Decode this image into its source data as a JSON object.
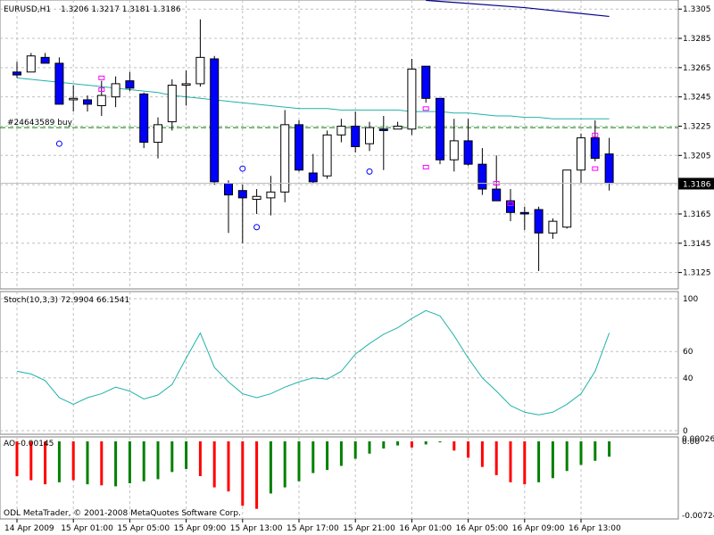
{
  "window": {
    "symbol_title": "EURUSD,H1",
    "ohlc_text": "1.3206 1.3217 1.3181 1.3186",
    "last_price_label": "1.3186",
    "order_label": "#24643589 buy",
    "copyright": "ODL MetaTrader, © 2001-2008 MetaQuotes Software Corp."
  },
  "colors": {
    "background": "#ffffff",
    "grid": "#c0c0c0",
    "bull_body": "#ffffff",
    "bear_body": "#0000ff",
    "wick": "#000000",
    "ma_line": "#20b2aa",
    "upper_line": "#00008b",
    "order_line": "#008000",
    "stoch_line": "#20b2aa",
    "ao_up": "#008000",
    "ao_down": "#ff0000",
    "marker_square": "#ff00ff",
    "marker_circle": "#0000ff"
  },
  "chart_data": [
    {
      "type": "candlestick",
      "title": "EURUSD,H1",
      "ylim": [
        1.3115,
        1.331
      ],
      "y_ticks": [
        "1.3305",
        "1.3285",
        "1.3265",
        "1.3245",
        "1.3225",
        "1.3205",
        "1.3185",
        "1.3165",
        "1.3145",
        "1.3125"
      ],
      "y_tick_values": [
        1.3305,
        1.3285,
        1.3265,
        1.3245,
        1.3225,
        1.3205,
        1.3185,
        1.3165,
        1.3145,
        1.3125
      ],
      "x_labels": [
        "14 Apr 2009",
        "15 Apr 01:00",
        "15 Apr 05:00",
        "15 Apr 09:00",
        "15 Apr 13:00",
        "15 Apr 17:00",
        "15 Apr 21:00",
        "16 Apr 01:00",
        "16 Apr 05:00",
        "16 Apr 09:00",
        "16 Apr 13:00"
      ],
      "x_label_bar_index": [
        0,
        4,
        8,
        12,
        16,
        20,
        24,
        28,
        32,
        36,
        40
      ],
      "candles": [
        {
          "o": 1.3262,
          "h": 1.3269,
          "l": 1.3258,
          "c": 1.326
        },
        {
          "o": 1.3262,
          "h": 1.3275,
          "l": 1.3262,
          "c": 1.3273
        },
        {
          "o": 1.3272,
          "h": 1.3275,
          "l": 1.3268,
          "c": 1.3268
        },
        {
          "o": 1.3268,
          "h": 1.3272,
          "l": 1.324,
          "c": 1.324
        },
        {
          "o": 1.3243,
          "h": 1.3253,
          "l": 1.3235,
          "c": 1.3244
        },
        {
          "o": 1.3243,
          "h": 1.3246,
          "l": 1.3235,
          "c": 1.324
        },
        {
          "o": 1.3239,
          "h": 1.3256,
          "l": 1.3232,
          "c": 1.3246
        },
        {
          "o": 1.3245,
          "h": 1.3259,
          "l": 1.3238,
          "c": 1.3254
        },
        {
          "o": 1.3256,
          "h": 1.3262,
          "l": 1.3249,
          "c": 1.3251
        },
        {
          "o": 1.3247,
          "h": 1.3248,
          "l": 1.321,
          "c": 1.3214
        },
        {
          "o": 1.3214,
          "h": 1.3231,
          "l": 1.3203,
          "c": 1.3226
        },
        {
          "o": 1.3228,
          "h": 1.3257,
          "l": 1.3222,
          "c": 1.3253
        },
        {
          "o": 1.3253,
          "h": 1.3263,
          "l": 1.3239,
          "c": 1.3254
        },
        {
          "o": 1.3254,
          "h": 1.3298,
          "l": 1.3252,
          "c": 1.3272
        },
        {
          "o": 1.3271,
          "h": 1.3273,
          "l": 1.3185,
          "c": 1.3187
        },
        {
          "o": 1.3186,
          "h": 1.3188,
          "l": 1.3152,
          "c": 1.3178
        },
        {
          "o": 1.3181,
          "h": 1.3185,
          "l": 1.3145,
          "c": 1.3176
        },
        {
          "o": 1.3175,
          "h": 1.3182,
          "l": 1.3165,
          "c": 1.3177
        },
        {
          "o": 1.3176,
          "h": 1.3191,
          "l": 1.3164,
          "c": 1.318
        },
        {
          "o": 1.318,
          "h": 1.3236,
          "l": 1.3173,
          "c": 1.3226
        },
        {
          "o": 1.3226,
          "h": 1.3229,
          "l": 1.3194,
          "c": 1.3195
        },
        {
          "o": 1.3193,
          "h": 1.3206,
          "l": 1.3186,
          "c": 1.3187
        },
        {
          "o": 1.3191,
          "h": 1.3222,
          "l": 1.3189,
          "c": 1.3219
        },
        {
          "o": 1.3219,
          "h": 1.323,
          "l": 1.3214,
          "c": 1.3225
        },
        {
          "o": 1.3225,
          "h": 1.3235,
          "l": 1.3207,
          "c": 1.3211
        },
        {
          "o": 1.3213,
          "h": 1.3228,
          "l": 1.3208,
          "c": 1.3224
        },
        {
          "o": 1.3223,
          "h": 1.3232,
          "l": 1.3195,
          "c": 1.3222
        },
        {
          "o": 1.3223,
          "h": 1.3228,
          "l": 1.3223,
          "c": 1.3225
        },
        {
          "o": 1.3223,
          "h": 1.3271,
          "l": 1.3219,
          "c": 1.3264
        },
        {
          "o": 1.3266,
          "h": 1.3266,
          "l": 1.3241,
          "c": 1.3244
        },
        {
          "o": 1.3244,
          "h": 1.3244,
          "l": 1.3199,
          "c": 1.3202
        },
        {
          "o": 1.3202,
          "h": 1.323,
          "l": 1.3194,
          "c": 1.3215
        },
        {
          "o": 1.3215,
          "h": 1.323,
          "l": 1.3198,
          "c": 1.3199
        },
        {
          "o": 1.3199,
          "h": 1.321,
          "l": 1.3178,
          "c": 1.3182
        },
        {
          "o": 1.3182,
          "h": 1.3205,
          "l": 1.3174,
          "c": 1.3174
        },
        {
          "o": 1.3174,
          "h": 1.3182,
          "l": 1.316,
          "c": 1.3166
        },
        {
          "o": 1.3166,
          "h": 1.317,
          "l": 1.3154,
          "c": 1.3165
        },
        {
          "o": 1.3168,
          "h": 1.317,
          "l": 1.3126,
          "c": 1.3152
        },
        {
          "o": 1.3152,
          "h": 1.3162,
          "l": 1.3148,
          "c": 1.316
        },
        {
          "o": 1.3156,
          "h": 1.3195,
          "l": 1.3155,
          "c": 1.3195
        },
        {
          "o": 1.3195,
          "h": 1.322,
          "l": 1.3186,
          "c": 1.3217
        },
        {
          "o": 1.3217,
          "h": 1.3229,
          "l": 1.3201,
          "c": 1.3203
        },
        {
          "o": 1.3206,
          "h": 1.3217,
          "l": 1.3181,
          "c": 1.3186
        }
      ],
      "moving_average": [
        1.3258,
        1.3257,
        1.3256,
        1.3255,
        1.3254,
        1.3253,
        1.3252,
        1.3251,
        1.325,
        1.3249,
        1.3248,
        1.3246,
        1.3245,
        1.3244,
        1.3243,
        1.3242,
        1.3241,
        1.324,
        1.3239,
        1.3238,
        1.3237,
        1.3237,
        1.3237,
        1.3236,
        1.3236,
        1.3236,
        1.3236,
        1.3236,
        1.3235,
        1.3235,
        1.3235,
        1.3234,
        1.3234,
        1.3233,
        1.3232,
        1.3232,
        1.3231,
        1.3231,
        1.323,
        1.323,
        1.323,
        1.323,
        1.323
      ],
      "upper_line": [
        {
          "bar": 29,
          "value": 1.3311
        },
        {
          "bar": 36,
          "value": 1.3306
        },
        {
          "bar": 42,
          "value": 1.33
        }
      ],
      "order_level": 1.3224,
      "sell_markers": [
        {
          "bar": 6,
          "value": 1.3258
        },
        {
          "bar": 6,
          "value": 1.325
        },
        {
          "bar": 29,
          "value": 1.3237
        },
        {
          "bar": 29,
          "value": 1.3197
        },
        {
          "bar": 34,
          "value": 1.3186
        },
        {
          "bar": 35,
          "value": 1.3172
        },
        {
          "bar": 41,
          "value": 1.3219
        },
        {
          "bar": 41,
          "value": 1.3196
        }
      ],
      "buy_markers": [
        {
          "bar": 3,
          "value": 1.3213
        },
        {
          "bar": 16,
          "value": 1.3196
        },
        {
          "bar": 17,
          "value": 1.3156
        },
        {
          "bar": 25,
          "value": 1.3194
        }
      ]
    },
    {
      "type": "line",
      "title": "Stoch(10,3,3) 72.9904 66.1541",
      "ylim": [
        0,
        100
      ],
      "y_ticks": [
        "100",
        "60",
        "40",
        "0"
      ],
      "y_tick_values": [
        100,
        60,
        40,
        0
      ],
      "values": [
        45,
        43,
        38,
        25,
        20,
        25,
        28,
        33,
        30,
        24,
        27,
        35,
        55,
        74,
        48,
        37,
        28,
        25,
        28,
        33,
        37,
        40,
        39,
        45,
        58,
        66,
        73,
        78,
        85,
        91,
        87,
        72,
        55,
        40,
        30,
        19,
        14,
        12,
        14,
        20,
        28,
        45,
        74
      ]
    },
    {
      "type": "bar",
      "title": "AO -0.00145",
      "ylim": [
        -0.00724,
        0.00026
      ],
      "y_ticks": [
        "0.00026",
        "0.00",
        "-0.00724"
      ],
      "y_tick_values": [
        0.00026,
        0.0,
        -0.00724
      ],
      "values": [
        -0.0034,
        -0.0038,
        -0.0042,
        -0.004,
        -0.0038,
        -0.0042,
        -0.0043,
        -0.0044,
        -0.0041,
        -0.0039,
        -0.0037,
        -0.003,
        -0.0027,
        -0.0034,
        -0.0045,
        -0.0049,
        -0.0063,
        -0.0066,
        -0.0051,
        -0.0045,
        -0.0039,
        -0.0031,
        -0.0028,
        -0.0024,
        -0.0017,
        -0.0012,
        -0.0007,
        -0.0004,
        -0.0006,
        -0.0003,
        -0.0001,
        -0.0009,
        -0.0016,
        -0.0025,
        -0.0033,
        -0.004,
        -0.0042,
        -0.004,
        -0.0036,
        -0.0029,
        -0.0023,
        -0.0019,
        -0.0015
      ],
      "colors": [
        "down",
        "down",
        "down",
        "up",
        "down",
        "up",
        "down",
        "up",
        "up",
        "up",
        "up",
        "up",
        "up",
        "down",
        "down",
        "down",
        "down",
        "down",
        "up",
        "up",
        "up",
        "up",
        "up",
        "up",
        "up",
        "up",
        "up",
        "up",
        "down",
        "up",
        "up",
        "down",
        "down",
        "down",
        "down",
        "down",
        "down",
        "up",
        "up",
        "up",
        "up",
        "up",
        "up"
      ]
    }
  ]
}
